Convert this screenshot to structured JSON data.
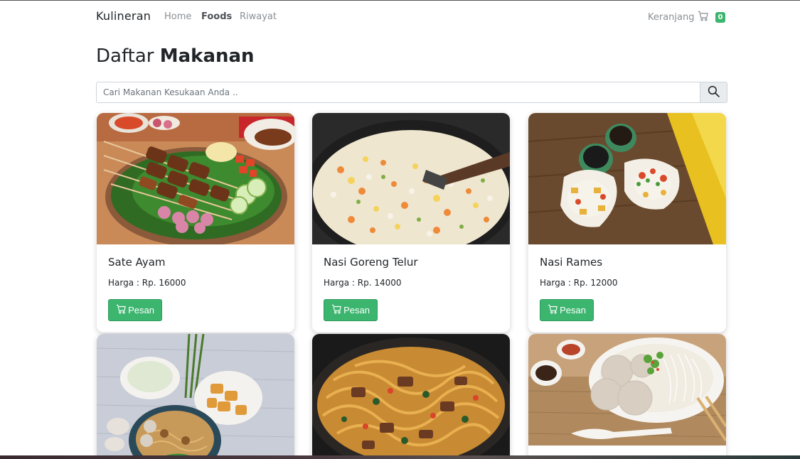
{
  "navbar": {
    "brand": "Kulineran",
    "links": [
      {
        "label": "Home",
        "active": false
      },
      {
        "label": "Foods",
        "active": true
      },
      {
        "label": "Riwayat",
        "active": false
      }
    ],
    "cart_label": "Keranjang",
    "cart_icon": "cart-icon",
    "cart_count": "0"
  },
  "page": {
    "heading_prefix": "Daftar",
    "heading_strong": "Makanan"
  },
  "search": {
    "placeholder": "Cari Makanan Kesukaan Anda ..",
    "icon": "search-icon"
  },
  "foods": [
    {
      "name": "Sate Ayam",
      "price": "Harga : Rp. 16000",
      "button": "Pesan",
      "image": "sate-ayam-photo"
    },
    {
      "name": "Nasi Goreng Telur",
      "price": "Harga : Rp. 14000",
      "button": "Pesan",
      "image": "nasi-goreng-photo"
    },
    {
      "name": "Nasi Rames",
      "price": "Harga : Rp. 12000",
      "button": "Pesan",
      "image": "nasi-rames-photo"
    },
    {
      "name": "",
      "price": "",
      "button": "",
      "image": "mie-ayam-photo"
    },
    {
      "name": "",
      "price": "",
      "button": "",
      "image": "fried-noodles-photo"
    },
    {
      "name": "",
      "price": "",
      "button": "",
      "image": "bakso-photo"
    }
  ],
  "colors": {
    "accent_green": "#3cb56f",
    "text_dark": "#212529",
    "nav_muted": "#8a8f94"
  }
}
